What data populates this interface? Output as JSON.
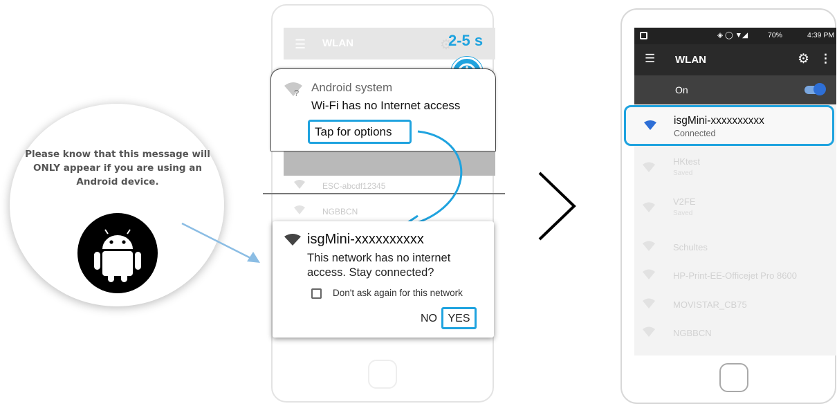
{
  "info_panel": {
    "message": "Please know that this message will ONLY appear if you are using an Android device.",
    "icon": "android-icon"
  },
  "timer": {
    "label": "2-5 s",
    "icon": "clock-icon"
  },
  "phone_before": {
    "app_bar_title": "WLAN",
    "background_networks": [
      "ESC-abcdf12345",
      "NGBBCN"
    ],
    "notification": {
      "app_name": "Android system",
      "message": "Wi-Fi has no Internet access",
      "action": "Tap for options"
    },
    "dialog": {
      "title": "isgMini-xxxxxxxxxx",
      "body": "This network has no internet access. Stay connected?",
      "checkbox_label": "Don't ask again for this network",
      "checkbox_checked": false,
      "no_label": "NO",
      "yes_label": "YES"
    }
  },
  "phone_after": {
    "status_bar": {
      "battery": "70%",
      "time": "4:39 PM"
    },
    "app_bar_title": "WLAN",
    "wifi_toggle_label": "On",
    "wifi_enabled": true,
    "connected_network": {
      "name": "isgMini-xxxxxxxxxx",
      "status": "Connected"
    },
    "networks": [
      {
        "name": "HKtest",
        "status": "Saved"
      },
      {
        "name": "V2FE",
        "status": "Saved"
      },
      {
        "name": "Schultes",
        "status": ""
      },
      {
        "name": "HP-Print-EE-Officejet Pro 8600",
        "status": ""
      },
      {
        "name": "MOVISTAR_CB75",
        "status": ""
      },
      {
        "name": "NGBBCN",
        "status": ""
      }
    ]
  },
  "colors": {
    "accent": "#1fa3df",
    "toggle": "#2e6fd6"
  }
}
